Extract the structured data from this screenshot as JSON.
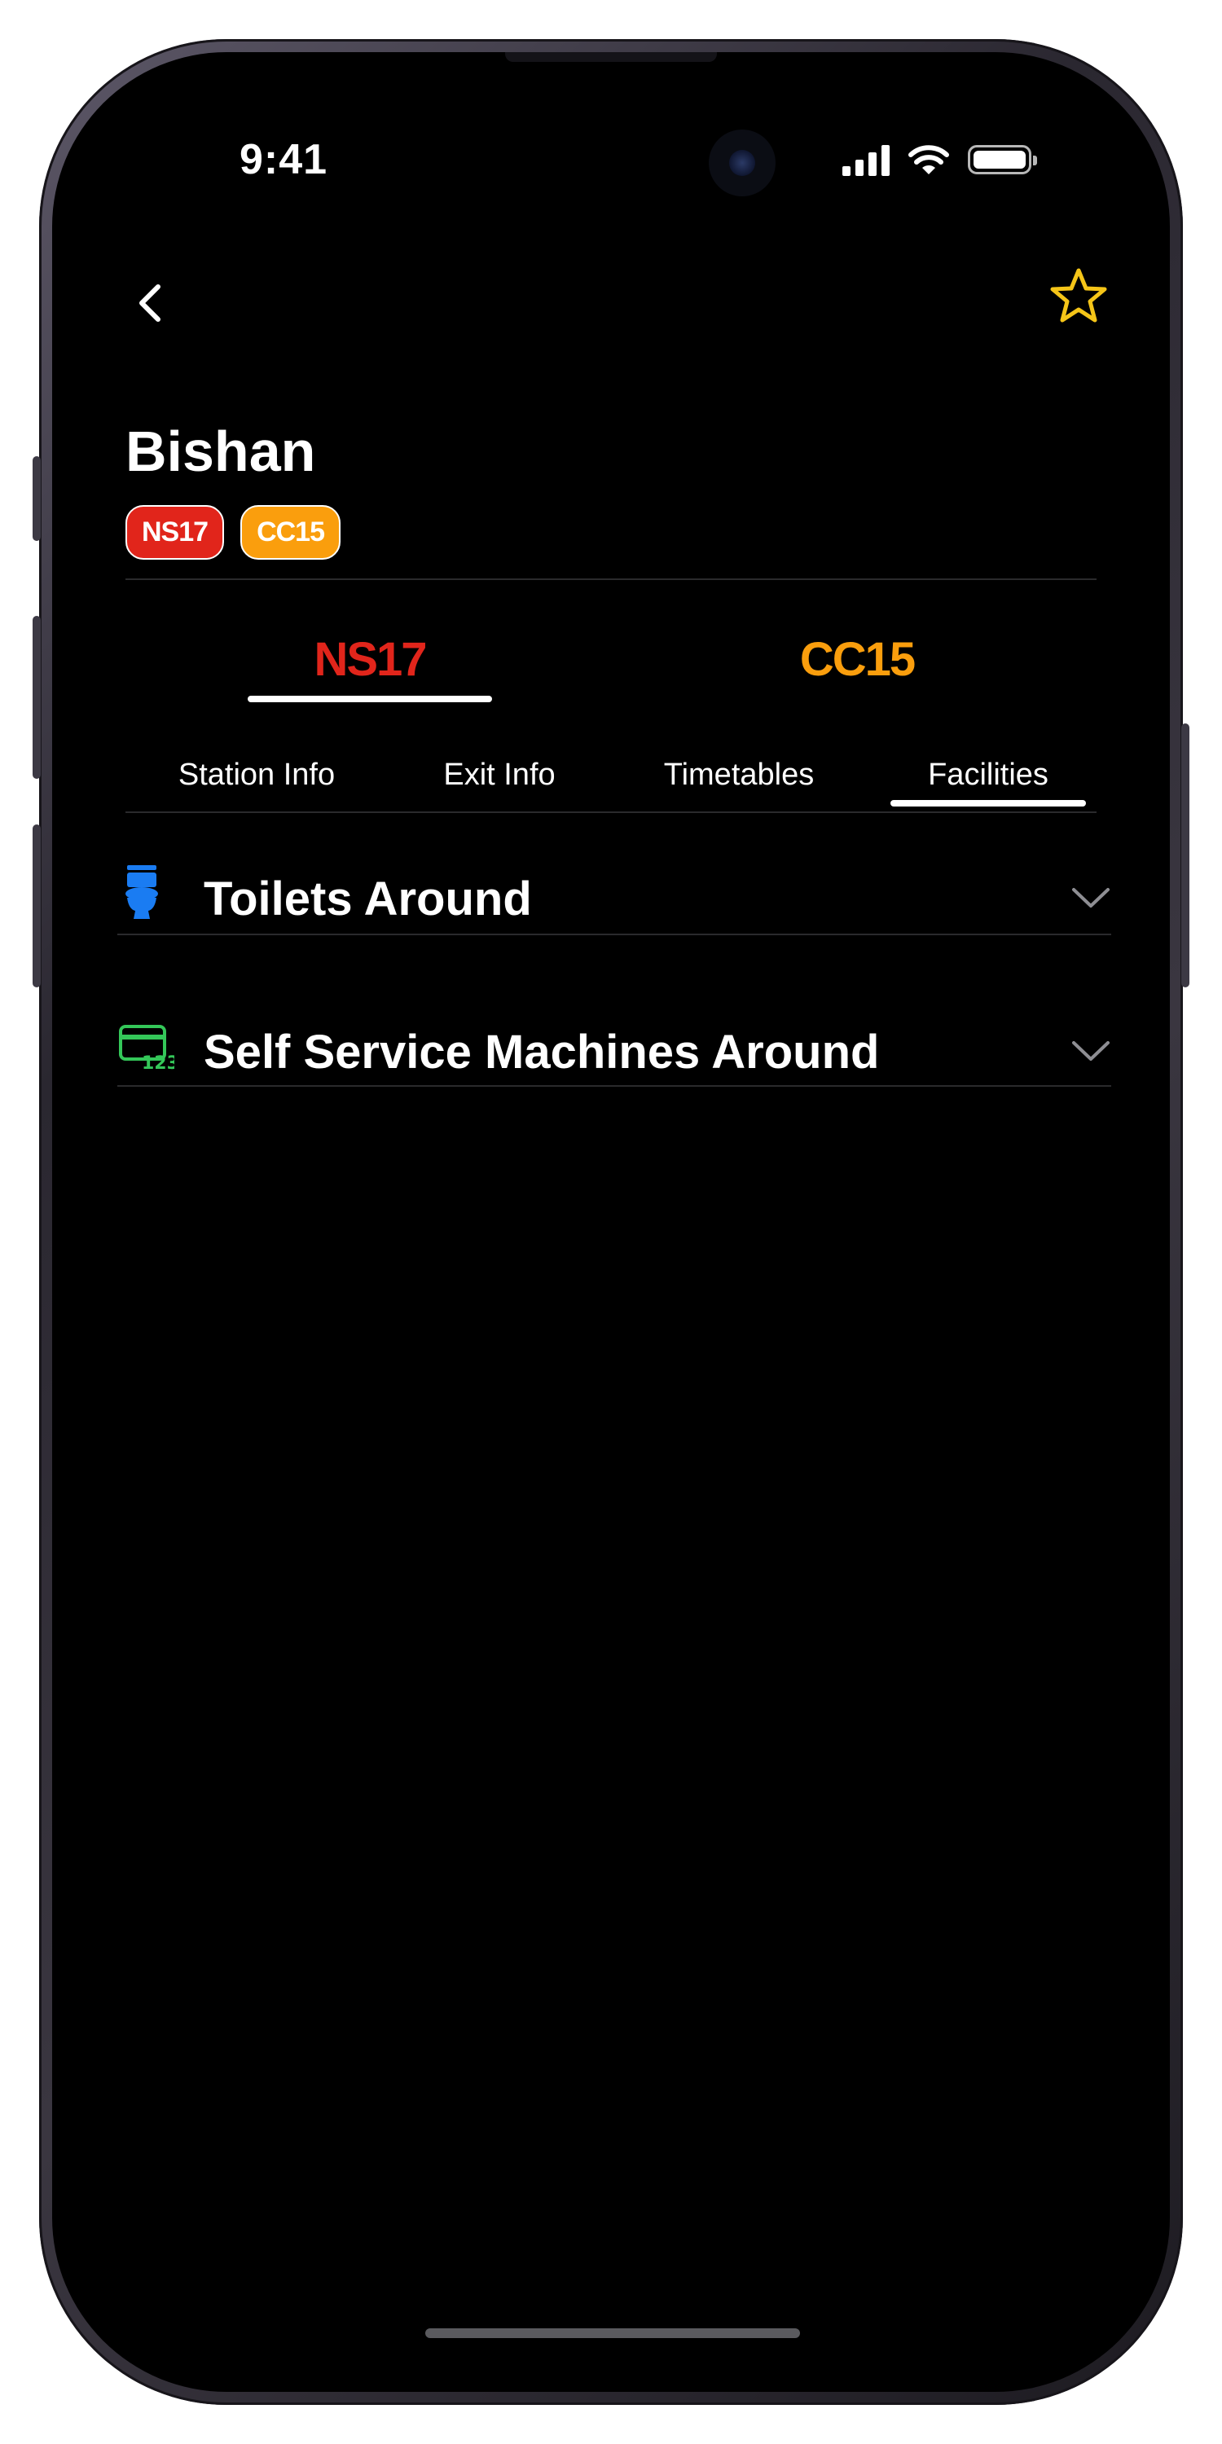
{
  "status_bar": {
    "time": "9:41"
  },
  "nav": {
    "back_icon": "chevron-left-icon",
    "favorite_icon": "star-icon",
    "favorite_color": "#f5c518"
  },
  "station": {
    "name": "Bishan",
    "codes": [
      {
        "label": "NS17",
        "color": "#e1251b"
      },
      {
        "label": "CC15",
        "color": "#fa9e0d"
      }
    ]
  },
  "line_tabs": [
    {
      "label": "NS17",
      "color": "#e1251b",
      "selected": true
    },
    {
      "label": "CC15",
      "color": "#fa9e0d",
      "selected": false
    }
  ],
  "sub_tabs": [
    "Station Info",
    "Exit Info",
    "Timetables",
    "Facilities"
  ],
  "selected_sub_tab": "Facilities",
  "sections": [
    {
      "label": "Toilets Around",
      "icon": "toilet-icon",
      "icon_color": "#1a7cf2"
    },
    {
      "label": "Self Service Machines Around",
      "icon": "ticket-machine-icon",
      "icon_color": "#34c759"
    }
  ]
}
